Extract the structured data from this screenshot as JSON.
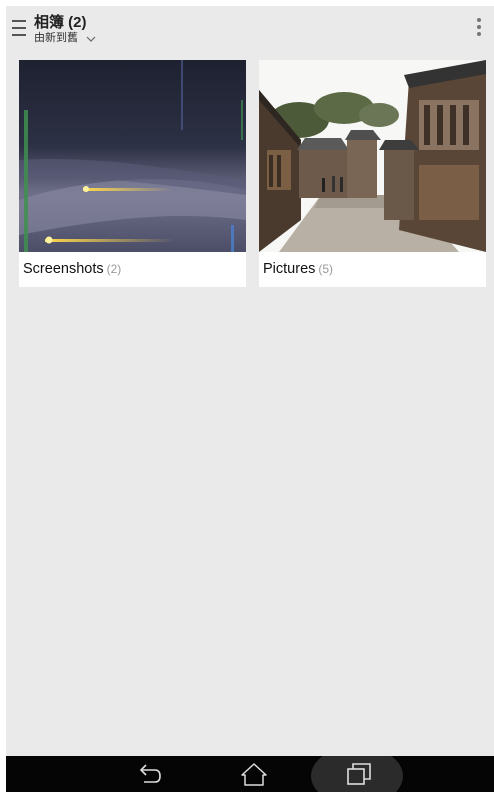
{
  "header": {
    "title": "相簿 (2)",
    "sort_label": "由新到舊"
  },
  "albums": [
    {
      "name": "Screenshots",
      "count": "(2)"
    },
    {
      "name": "Pictures",
      "count": "(5)"
    }
  ],
  "icons": {
    "menu": "menu-icon",
    "sort": "chevron-down-icon",
    "overflow": "more-vertical-icon",
    "back": "back-icon",
    "home": "home-icon",
    "recent": "recent-apps-icon"
  }
}
